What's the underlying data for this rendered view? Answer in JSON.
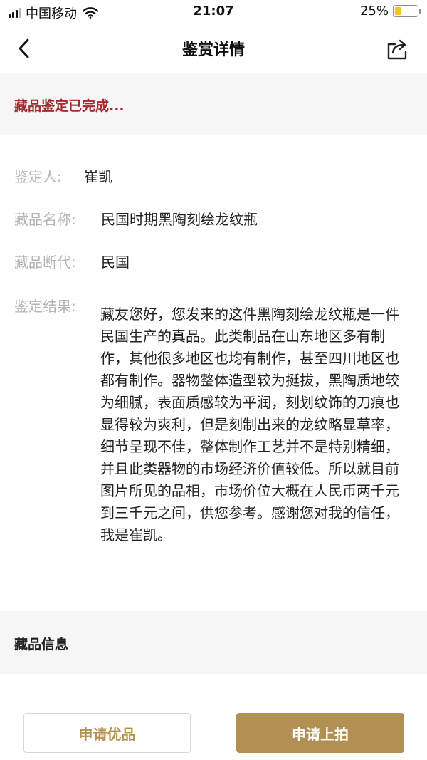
{
  "status_bar": {
    "carrier": "中国移动",
    "time": "21:07",
    "battery_percent": "25%",
    "battery_level": 0.25
  },
  "nav": {
    "title": "鉴赏详情",
    "back_icon": "chevron-left-icon",
    "share_icon": "share-icon"
  },
  "banner": {
    "text": "藏品鉴定已完成..."
  },
  "details": {
    "appraiser_label": "鉴定人:",
    "appraiser_value": "崔凯",
    "name_label": "藏品名称:",
    "name_value": "民国时期黑陶刻绘龙纹瓶",
    "era_label": "藏品断代:",
    "era_value": "民国",
    "result_label": "鉴定结果:",
    "result_value": "藏友您好，您发来的这件黑陶刻绘龙纹瓶是一件民国生产的真品。此类制品在山东地区多有制作，其他很多地区也均有制作，甚至四川地区也都有制作。器物整体造型较为挺拔，黑陶质地较为细腻，表面质感较为平润，刻划纹饰的刀痕也显得较为爽利，但是刻制出来的龙纹略显草率，细节呈现不佳，整体制作工艺并不是特别精细，并且此类器物的市场经济价值较低。所以就目前图片所见的品相，市场价位大概在人民币两千元到三千元之间，供您参考。感谢您对我的信任，我是崔凯。"
  },
  "section": {
    "title": "藏品信息"
  },
  "actions": {
    "apply_premium": "申请优品",
    "apply_auction": "申请上拍"
  },
  "colors": {
    "banner_text": "#a8282e",
    "accent_gold": "#b28f52",
    "label_gray": "#b4b4b4"
  }
}
